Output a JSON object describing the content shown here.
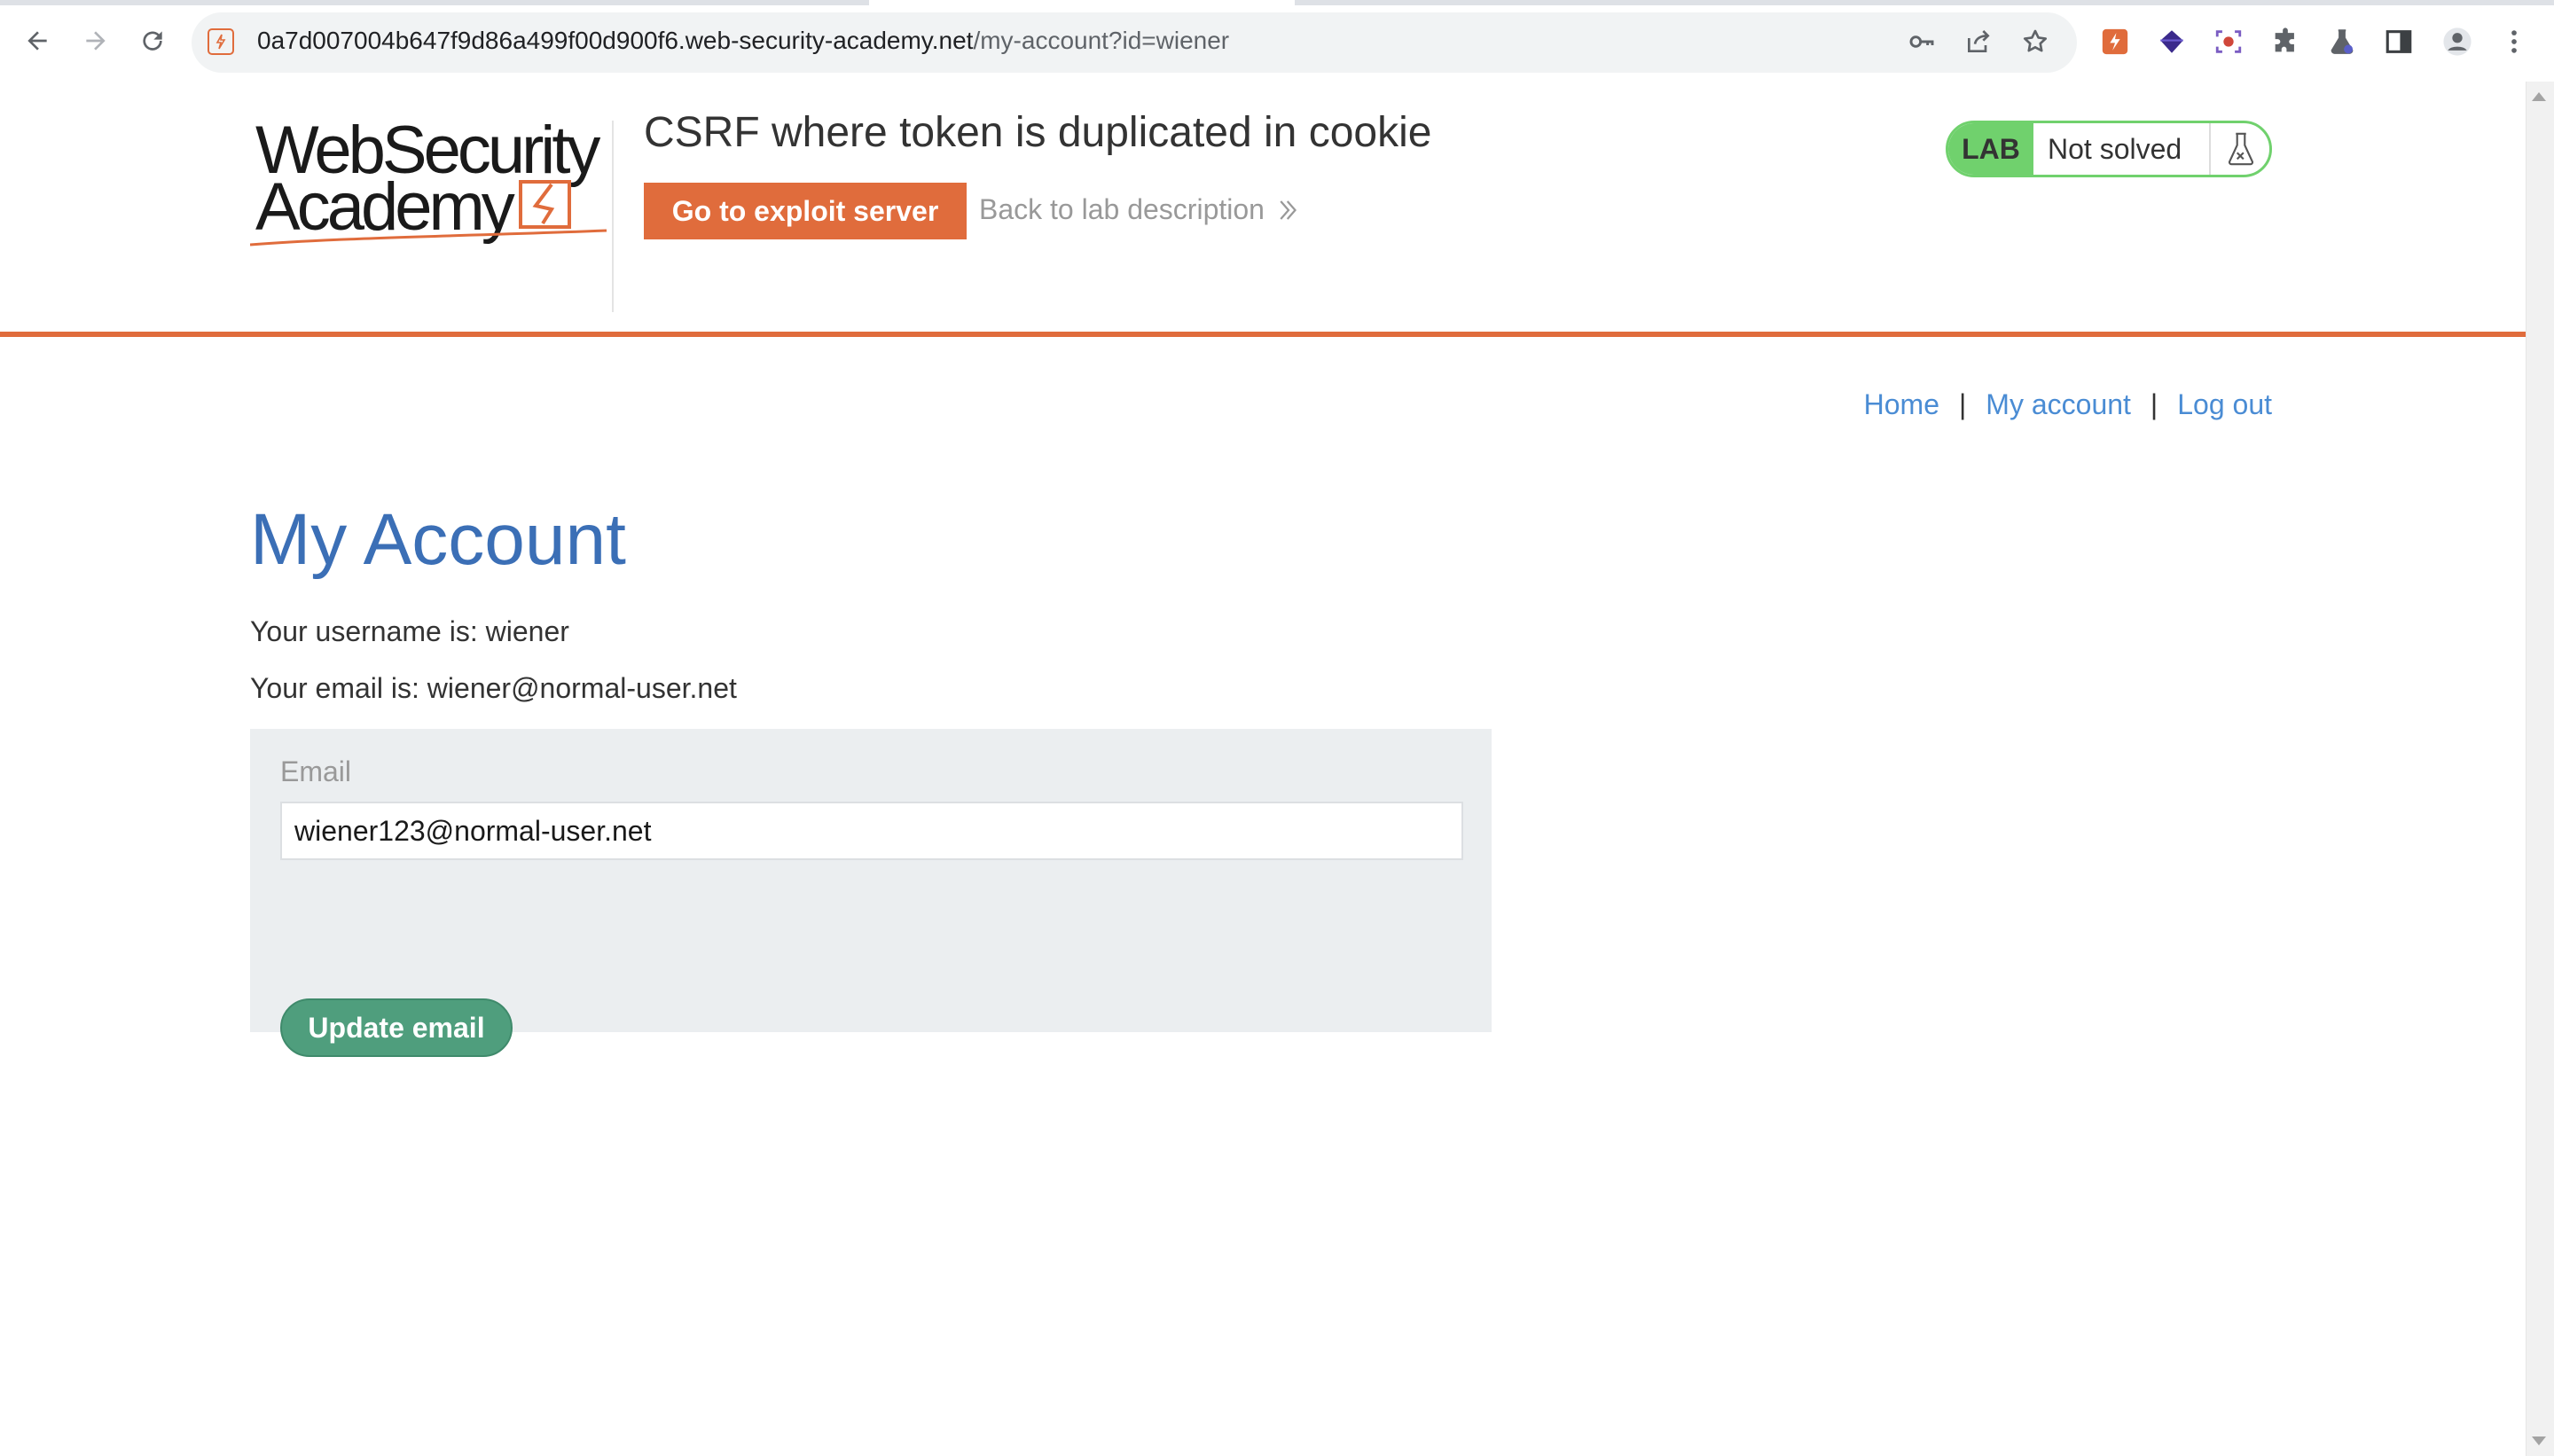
{
  "browser": {
    "url_host": "0a7d007004b647f9d86a499f00d900f6.web-security-academy.net",
    "url_path": "/my-account?id=wiener",
    "icons": {
      "back": "back-arrow-icon",
      "forward": "forward-arrow-icon",
      "reload": "reload-icon",
      "site": "lightning-icon",
      "password": "key-icon",
      "share": "share-icon",
      "bookmark": "star-icon",
      "extensions": [
        "burp-extension-icon",
        "diamond-extension-icon",
        "screen-capture-extension-icon",
        "puzzle-icon",
        "flask-extension-icon"
      ],
      "side_panel": "side-panel-icon",
      "profile": "profile-icon",
      "menu": "kebab-menu-icon"
    }
  },
  "header": {
    "logo_line1": "WebSecurity",
    "logo_line2": "Academy",
    "lab_title": "CSRF where token is duplicated in cookie",
    "exploit_button": "Go to exploit server",
    "back_link": "Back to lab description",
    "lab_badge": "LAB",
    "lab_status": "Not solved"
  },
  "nav": {
    "items": [
      {
        "label": "Home"
      },
      {
        "label": "My account"
      },
      {
        "label": "Log out"
      }
    ],
    "separator": "|"
  },
  "main": {
    "heading": "My Account",
    "username_line": "Your username is: wiener",
    "email_line": "Your email is: wiener@normal-user.net",
    "form": {
      "label": "Email",
      "value": "wiener123@normal-user.net",
      "submit": "Update email"
    }
  },
  "colors": {
    "accent_orange": "#e06c3c",
    "heading_blue": "#3b6fb6",
    "link_blue": "#4a8cd4",
    "status_green": "#70d16d",
    "button_green": "#4f9e7d",
    "panel_gray": "#ebeef0"
  }
}
